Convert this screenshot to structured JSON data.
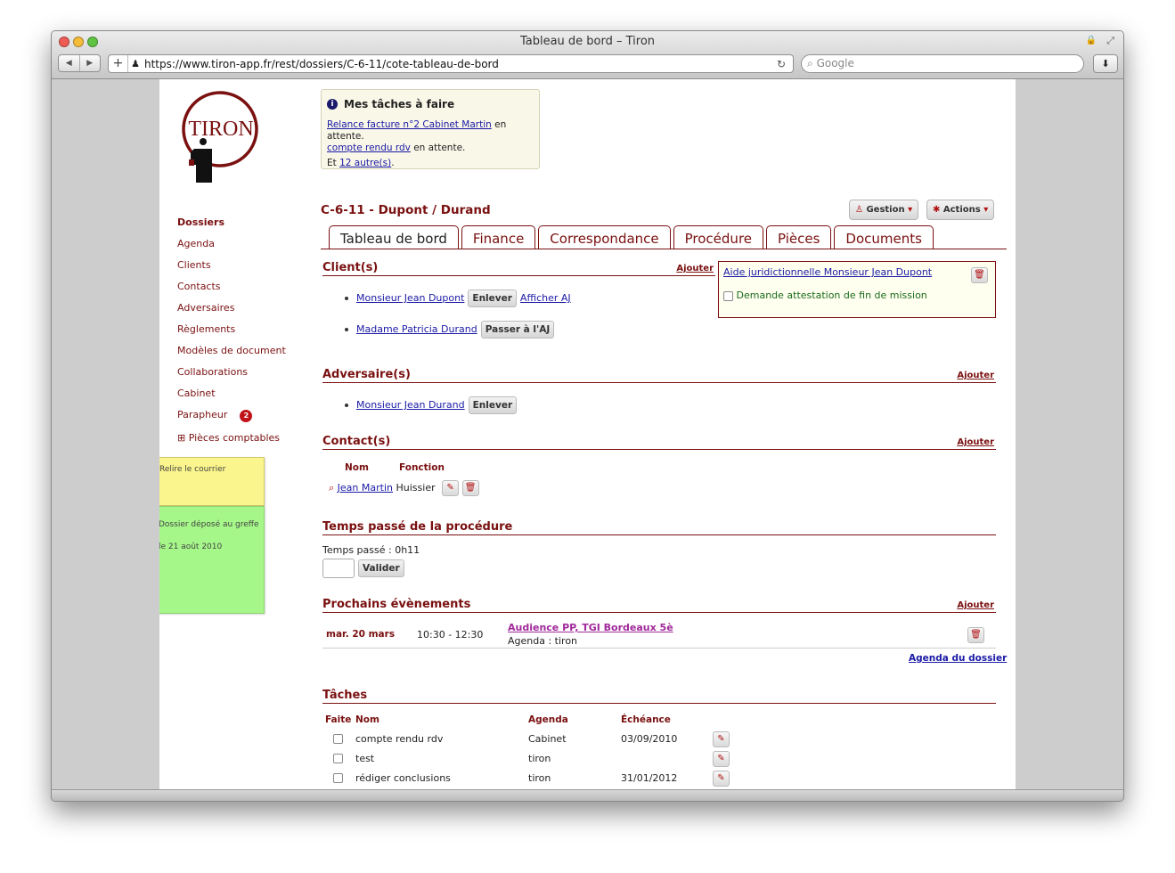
{
  "window": {
    "title": "Tableau de bord – Tiron"
  },
  "browser": {
    "url": "https://www.tiron-app.fr/rest/dossiers/C-6-11/cote-tableau-de-bord",
    "search_placeholder": "Google"
  },
  "logo": {
    "text": "TIRON"
  },
  "sidebar": {
    "items": [
      {
        "label": "Dossiers",
        "active": true
      },
      {
        "label": "Agenda"
      },
      {
        "label": "Clients"
      },
      {
        "label": "Contacts"
      },
      {
        "label": "Adversaires"
      },
      {
        "label": "Règlements"
      },
      {
        "label": "Modèles de document"
      },
      {
        "label": "Collaborations"
      },
      {
        "label": "Cabinet"
      },
      {
        "label": "Parapheur",
        "badge": "2"
      },
      {
        "label": "⊞ Pièces comptables"
      }
    ]
  },
  "stickies": [
    {
      "text": "Relire le courrier"
    },
    {
      "text": "Dossier déposé au greffe le 21 août 2010"
    }
  ],
  "todo": {
    "title": "Mes tâches à faire",
    "item1_link": "Relance facture n°2 Cabinet Martin",
    "item1_suffix": " en attente.",
    "item2_link": "compte rendu rdv",
    "item2_suffix": " en attente.",
    "more_prefix": "Et ",
    "more_link": "12 autre(s)",
    "more_suffix": "."
  },
  "case": {
    "title": "C-6-11 - Dupont / Durand",
    "gestion": "Gestion",
    "actions": "Actions"
  },
  "tabs": [
    "Tableau de bord",
    "Finance",
    "Correspondance",
    "Procédure",
    "Pièces",
    "Documents"
  ],
  "clients": {
    "title": "Client(s)",
    "add": "Ajouter",
    "rows": [
      {
        "name": "Monsieur Jean Dupont",
        "btn": "Enlever",
        "link": "Afficher AJ"
      },
      {
        "name": "Madame Patricia Durand",
        "btn": "Passer à l'AJ"
      }
    ]
  },
  "aj": {
    "link": "Aide juridictionnelle Monsieur Jean Dupont",
    "check": "Demande attestation de fin de mission"
  },
  "adversaires": {
    "title": "Adversaire(s)",
    "add": "Ajouter",
    "name": "Monsieur Jean Durand",
    "btn": "Enlever"
  },
  "contacts": {
    "title": "Contact(s)",
    "add": "Ajouter",
    "col_nom": "Nom",
    "col_fonction": "Fonction",
    "name": "Jean Martin",
    "fonction": "Huissier"
  },
  "temps": {
    "title": "Temps passé de la procédure",
    "label": "Temps passé : 0h11",
    "btn": "Valider"
  },
  "events": {
    "title": "Prochains évènements",
    "add": "Ajouter",
    "date": "mar. 20 mars",
    "time": "10:30 - 12:30",
    "name": "Audience PP, TGI Bordeaux 5è",
    "agenda": "Agenda : tiron",
    "footer_link": "Agenda du dossier"
  },
  "taches": {
    "title": "Tâches",
    "cols": [
      "Faite",
      "Nom",
      "Agenda",
      "Échéance"
    ],
    "rows": [
      {
        "nom": "compte rendu rdv",
        "agenda": "Cabinet",
        "echeance": "03/09/2010"
      },
      {
        "nom": "test",
        "agenda": "tiron",
        "echeance": ""
      },
      {
        "nom": "rédiger conclusions",
        "agenda": "tiron",
        "echeance": "31/01/2012"
      }
    ]
  }
}
